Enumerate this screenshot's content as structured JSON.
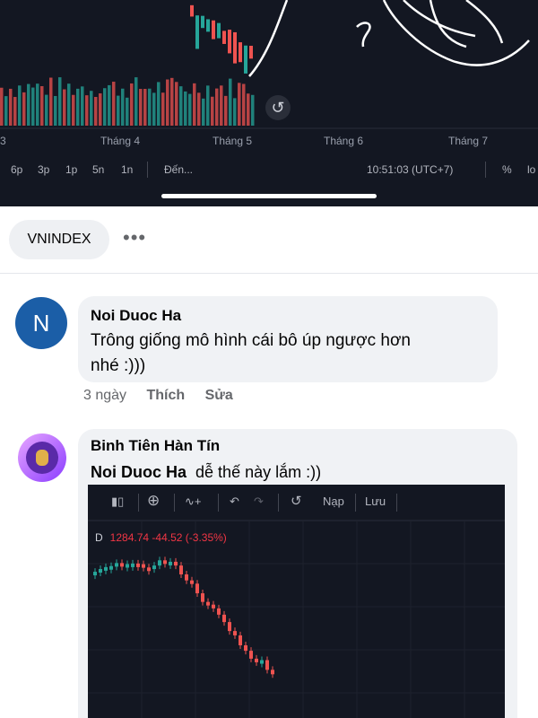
{
  "top_chart": {
    "months": [
      "3",
      "Tháng 4",
      "Tháng 5",
      "Tháng 6",
      "Tháng 7"
    ],
    "reset_icon": "reset-icon",
    "timeframes": [
      "6p",
      "3p",
      "1p",
      "5n",
      "1n"
    ],
    "goto_label": "Đến...",
    "time": "10:51:03 (UTC+7)",
    "percent_label": "%",
    "log_label": "lo",
    "colors": {
      "up": "#26a69a",
      "down": "#ef5350",
      "bg": "#131722"
    }
  },
  "tag": {
    "chip": "VNINDEX",
    "more": "•••"
  },
  "comments": [
    {
      "avatar_letter": "N",
      "author": "Noi Duoc Ha",
      "text_line1": "Trông giống mô hình cái bô úp ngược hơn",
      "text_line2": "nhé :)))",
      "time": "3 ngày",
      "like": "Thích",
      "edit": "Sửa"
    },
    {
      "author": "Binh Tiên Hàn Tín",
      "mention": "Noi Duoc Ha",
      "text": "dễ thế này lắm :))"
    }
  ],
  "embedded_chart": {
    "toolbar": {
      "reset_icon": "reset-icon",
      "load": "Nạp",
      "save": "Lưu"
    },
    "interval": "D",
    "price": "1284.74",
    "change": "-44.52",
    "change_pct": "(-3.35%)"
  }
}
